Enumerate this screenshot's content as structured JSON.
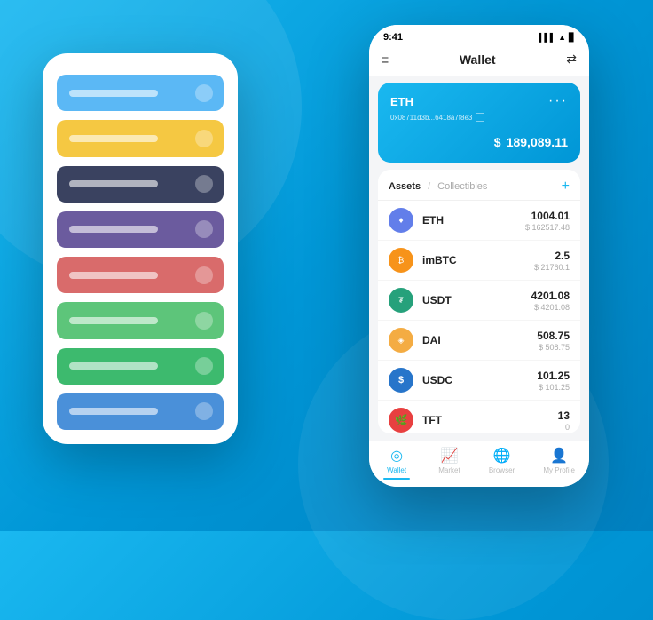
{
  "background": {
    "color1": "#1ab8f0",
    "color2": "#0080c0"
  },
  "back_phone": {
    "items": [
      {
        "color": "item-blue",
        "label": ""
      },
      {
        "color": "item-yellow",
        "label": ""
      },
      {
        "color": "item-dark",
        "label": ""
      },
      {
        "color": "item-purple",
        "label": ""
      },
      {
        "color": "item-red",
        "label": ""
      },
      {
        "color": "item-green1",
        "label": ""
      },
      {
        "color": "item-green2",
        "label": ""
      },
      {
        "color": "item-blue2",
        "label": ""
      }
    ]
  },
  "front_phone": {
    "status_bar": {
      "time": "9:41",
      "signal": "▌▌▌",
      "wifi": "▲",
      "battery": "▊"
    },
    "header": {
      "menu_icon": "≡",
      "title": "Wallet",
      "scan_icon": "⇄"
    },
    "wallet_card": {
      "ticker": "ETH",
      "address": "0x08711d3b...6418a7f8e3",
      "more_icon": "···",
      "currency_symbol": "$",
      "balance": "189,089.11"
    },
    "assets": {
      "tab_active": "Assets",
      "tab_divider": "/",
      "tab_inactive": "Collectibles",
      "add_icon": "+",
      "items": [
        {
          "symbol": "ETH",
          "name": "ETH",
          "icon": "♦",
          "icon_class": "icon-eth",
          "amount": "1004.01",
          "usd": "$ 162517.48"
        },
        {
          "symbol": "imBTC",
          "name": "imBTC",
          "icon": "₿",
          "icon_class": "icon-btc",
          "amount": "2.5",
          "usd": "$ 21760.1"
        },
        {
          "symbol": "USDT",
          "name": "USDT",
          "icon": "₮",
          "icon_class": "icon-usdt",
          "amount": "4201.08",
          "usd": "$ 4201.08"
        },
        {
          "symbol": "DAI",
          "name": "DAI",
          "icon": "◈",
          "icon_class": "icon-dai",
          "amount": "508.75",
          "usd": "$ 508.75"
        },
        {
          "symbol": "USDC",
          "name": "USDC",
          "icon": "$",
          "icon_class": "icon-usdc",
          "amount": "101.25",
          "usd": "$ 101.25"
        },
        {
          "symbol": "TFT",
          "name": "TFT",
          "icon": "🌿",
          "icon_class": "icon-tft",
          "amount": "13",
          "usd": "0"
        }
      ]
    },
    "nav": [
      {
        "icon": "◎",
        "label": "Wallet",
        "active": true
      },
      {
        "icon": "📈",
        "label": "Market",
        "active": false
      },
      {
        "icon": "🌐",
        "label": "Browser",
        "active": false
      },
      {
        "icon": "👤",
        "label": "My Profile",
        "active": false
      }
    ]
  }
}
